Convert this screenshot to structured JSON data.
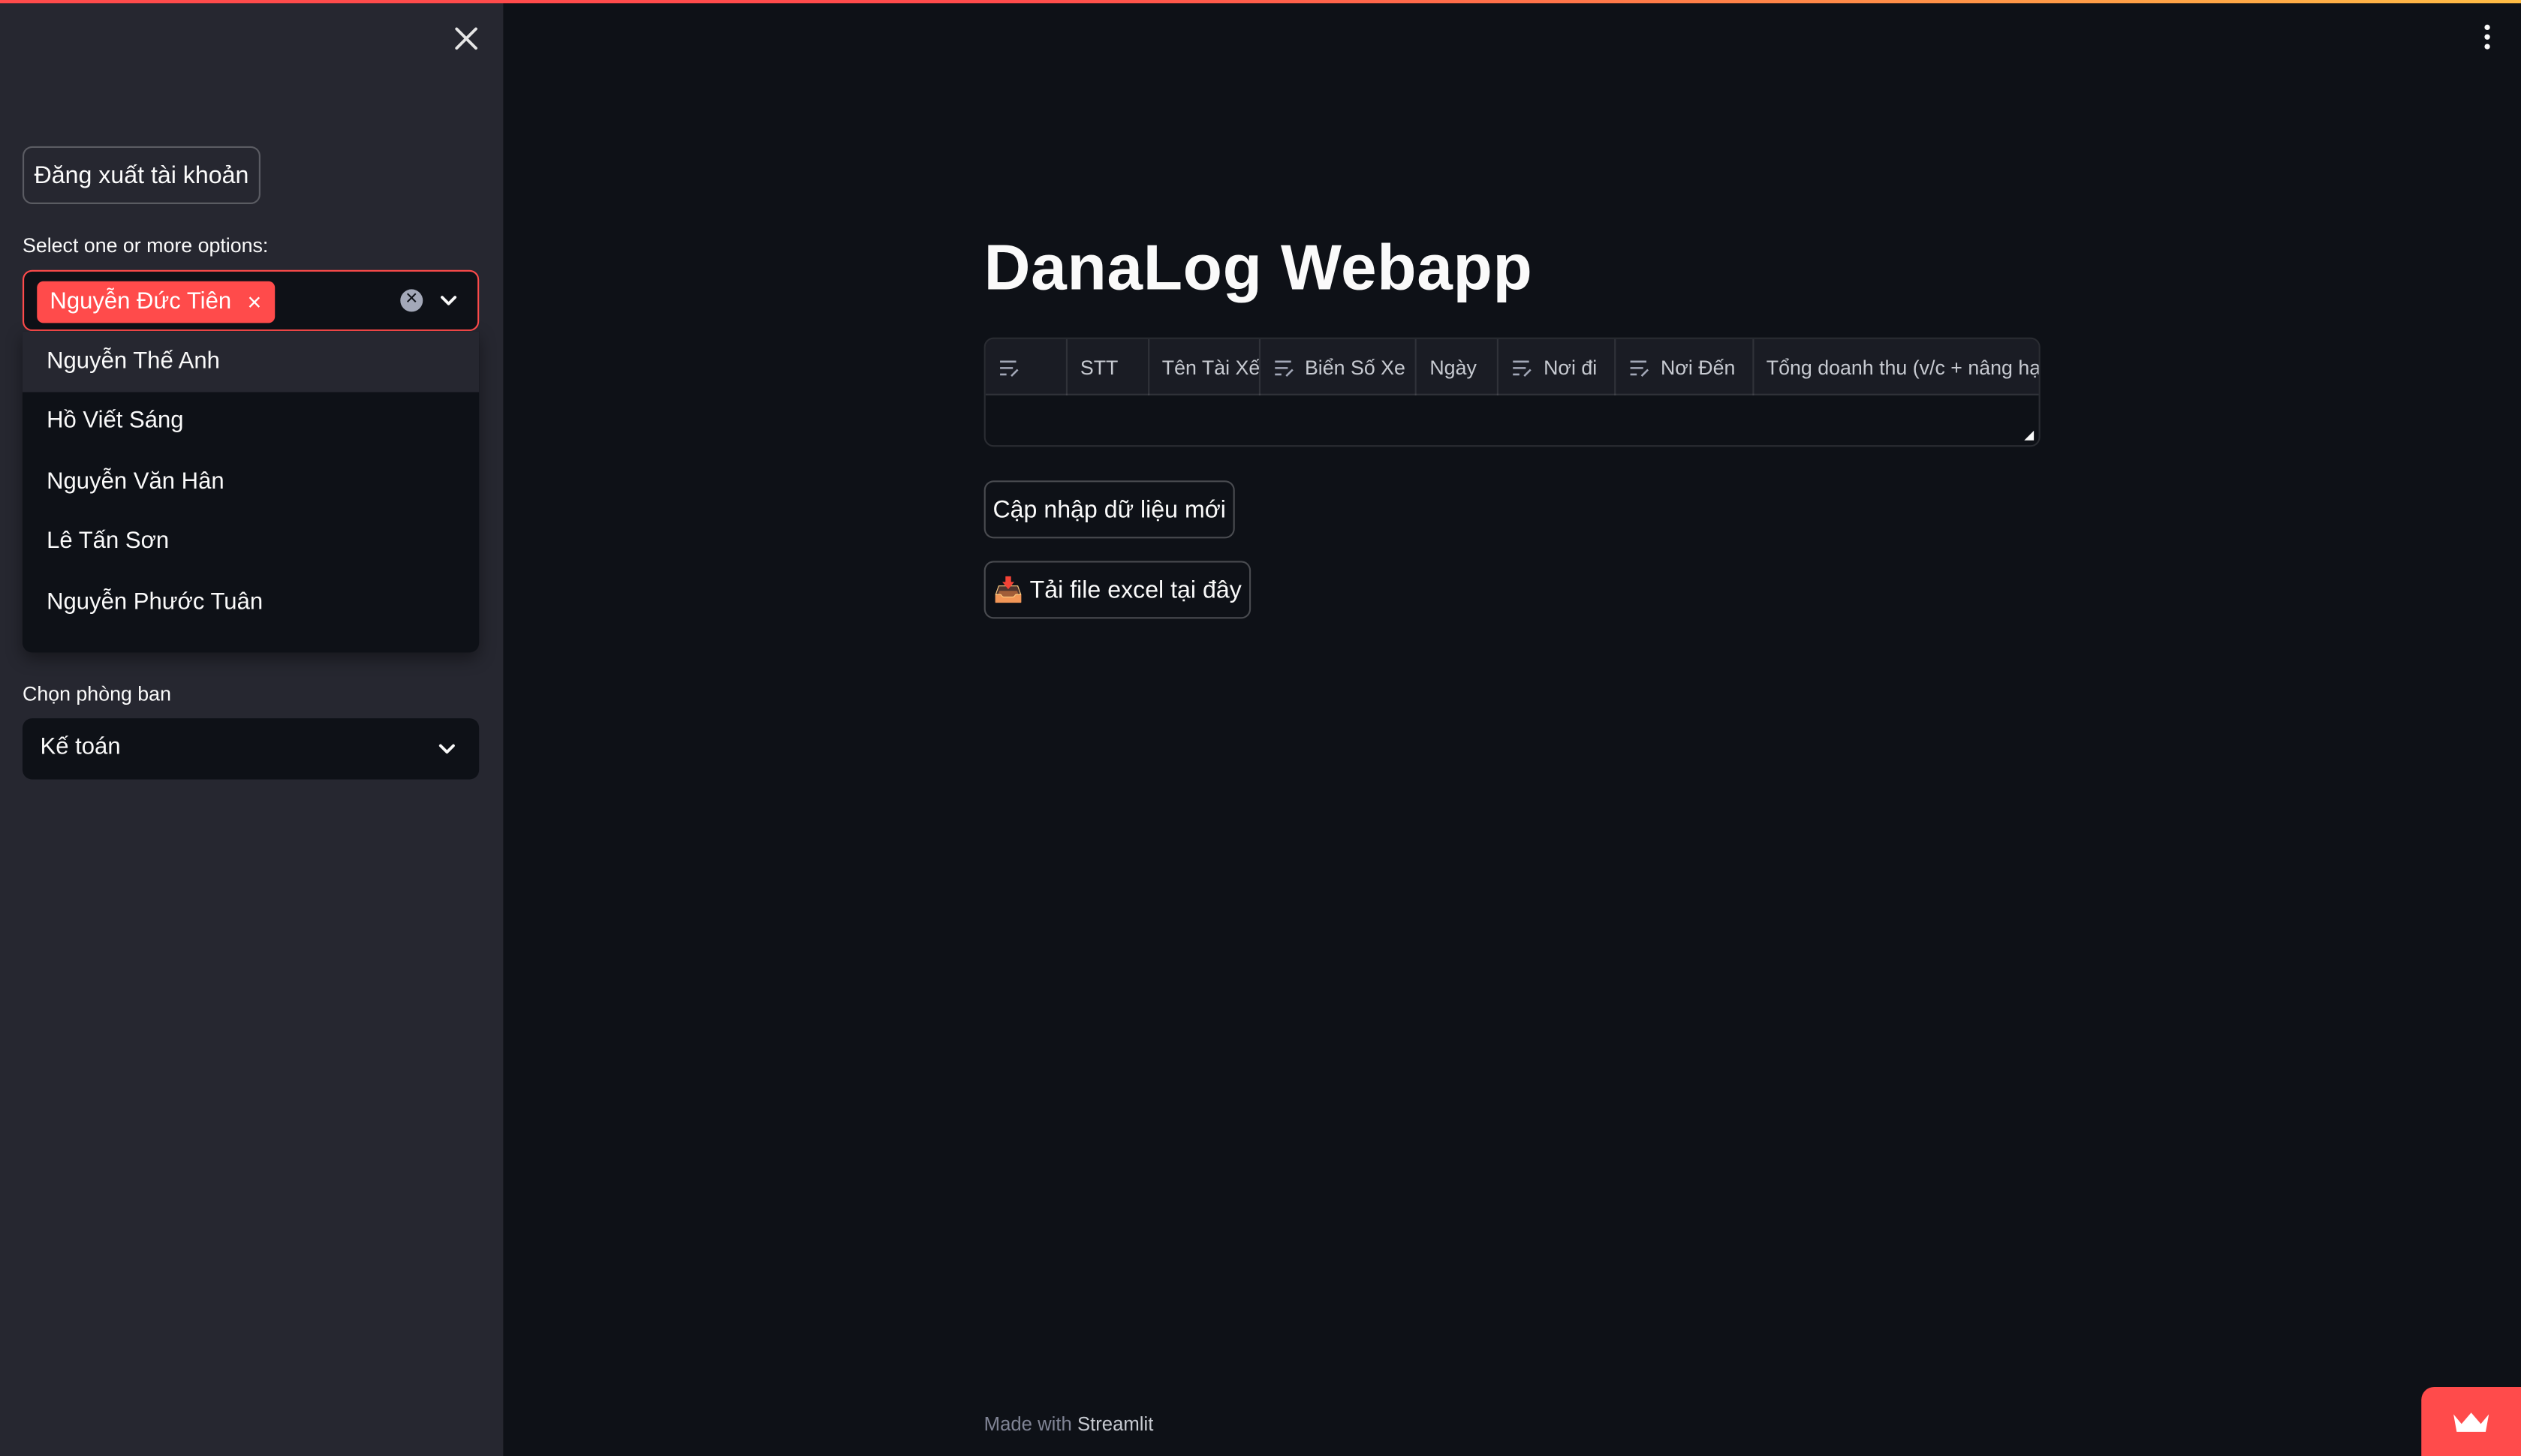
{
  "sidebar": {
    "logout_label": "Đăng xuất tài khoản",
    "multiselect": {
      "label": "Select one or more options:",
      "selected": [
        "Nguyễn Đức Tiên"
      ],
      "tag_remove": "×",
      "options": [
        "Nguyễn Thế Anh",
        "Hồ Viết Sáng",
        "Nguyễn Văn Hân",
        "Lê Tấn Sơn",
        "Nguyễn Phước Tuân"
      ]
    },
    "department": {
      "label": "Chọn phòng ban",
      "value": "Kế toán"
    }
  },
  "main": {
    "title": "DanaLog Webapp",
    "table": {
      "columns": [
        "STT",
        "Tên Tài Xế",
        "Biển Số Xe",
        "Ngày",
        "Nơi đi",
        "Nơi Đến",
        "Tổng doanh thu (v/c + nâng hạ"
      ]
    },
    "update_button": "Cập nhập dữ liệu mới",
    "download_button": "Tải file excel tại đây",
    "download_icon": "📥"
  },
  "footer": {
    "prefix": "Made with",
    "brand": "Streamlit"
  },
  "colors": {
    "primary": "#ff4b4b",
    "background": "#0e1117",
    "sidebar": "#262730"
  }
}
